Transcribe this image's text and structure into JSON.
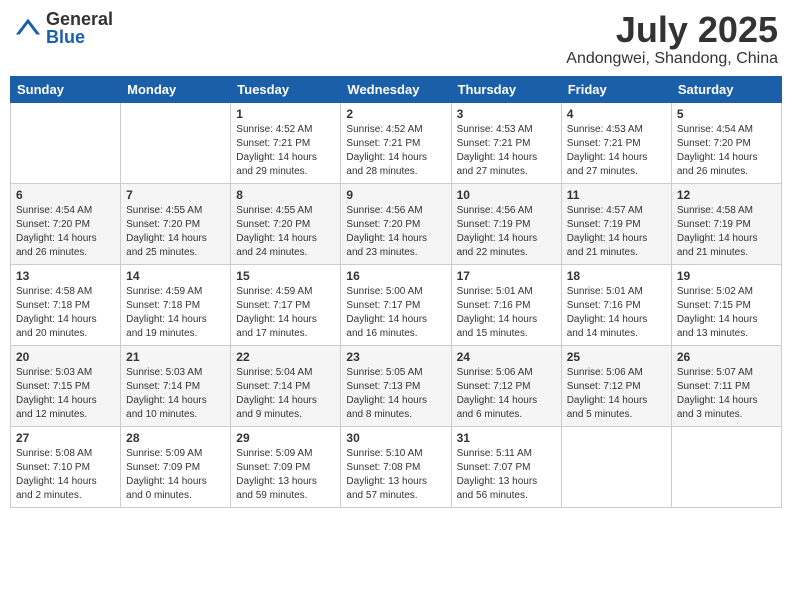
{
  "header": {
    "logo_general": "General",
    "logo_blue": "Blue",
    "month_title": "July 2025",
    "location": "Andongwei, Shandong, China"
  },
  "weekdays": [
    "Sunday",
    "Monday",
    "Tuesday",
    "Wednesday",
    "Thursday",
    "Friday",
    "Saturday"
  ],
  "weeks": [
    [
      {
        "day": null,
        "info": null
      },
      {
        "day": null,
        "info": null
      },
      {
        "day": "1",
        "info": "Sunrise: 4:52 AM\nSunset: 7:21 PM\nDaylight: 14 hours\nand 29 minutes."
      },
      {
        "day": "2",
        "info": "Sunrise: 4:52 AM\nSunset: 7:21 PM\nDaylight: 14 hours\nand 28 minutes."
      },
      {
        "day": "3",
        "info": "Sunrise: 4:53 AM\nSunset: 7:21 PM\nDaylight: 14 hours\nand 27 minutes."
      },
      {
        "day": "4",
        "info": "Sunrise: 4:53 AM\nSunset: 7:21 PM\nDaylight: 14 hours\nand 27 minutes."
      },
      {
        "day": "5",
        "info": "Sunrise: 4:54 AM\nSunset: 7:20 PM\nDaylight: 14 hours\nand 26 minutes."
      }
    ],
    [
      {
        "day": "6",
        "info": "Sunrise: 4:54 AM\nSunset: 7:20 PM\nDaylight: 14 hours\nand 26 minutes."
      },
      {
        "day": "7",
        "info": "Sunrise: 4:55 AM\nSunset: 7:20 PM\nDaylight: 14 hours\nand 25 minutes."
      },
      {
        "day": "8",
        "info": "Sunrise: 4:55 AM\nSunset: 7:20 PM\nDaylight: 14 hours\nand 24 minutes."
      },
      {
        "day": "9",
        "info": "Sunrise: 4:56 AM\nSunset: 7:20 PM\nDaylight: 14 hours\nand 23 minutes."
      },
      {
        "day": "10",
        "info": "Sunrise: 4:56 AM\nSunset: 7:19 PM\nDaylight: 14 hours\nand 22 minutes."
      },
      {
        "day": "11",
        "info": "Sunrise: 4:57 AM\nSunset: 7:19 PM\nDaylight: 14 hours\nand 21 minutes."
      },
      {
        "day": "12",
        "info": "Sunrise: 4:58 AM\nSunset: 7:19 PM\nDaylight: 14 hours\nand 21 minutes."
      }
    ],
    [
      {
        "day": "13",
        "info": "Sunrise: 4:58 AM\nSunset: 7:18 PM\nDaylight: 14 hours\nand 20 minutes."
      },
      {
        "day": "14",
        "info": "Sunrise: 4:59 AM\nSunset: 7:18 PM\nDaylight: 14 hours\nand 19 minutes."
      },
      {
        "day": "15",
        "info": "Sunrise: 4:59 AM\nSunset: 7:17 PM\nDaylight: 14 hours\nand 17 minutes."
      },
      {
        "day": "16",
        "info": "Sunrise: 5:00 AM\nSunset: 7:17 PM\nDaylight: 14 hours\nand 16 minutes."
      },
      {
        "day": "17",
        "info": "Sunrise: 5:01 AM\nSunset: 7:16 PM\nDaylight: 14 hours\nand 15 minutes."
      },
      {
        "day": "18",
        "info": "Sunrise: 5:01 AM\nSunset: 7:16 PM\nDaylight: 14 hours\nand 14 minutes."
      },
      {
        "day": "19",
        "info": "Sunrise: 5:02 AM\nSunset: 7:15 PM\nDaylight: 14 hours\nand 13 minutes."
      }
    ],
    [
      {
        "day": "20",
        "info": "Sunrise: 5:03 AM\nSunset: 7:15 PM\nDaylight: 14 hours\nand 12 minutes."
      },
      {
        "day": "21",
        "info": "Sunrise: 5:03 AM\nSunset: 7:14 PM\nDaylight: 14 hours\nand 10 minutes."
      },
      {
        "day": "22",
        "info": "Sunrise: 5:04 AM\nSunset: 7:14 PM\nDaylight: 14 hours\nand 9 minutes."
      },
      {
        "day": "23",
        "info": "Sunrise: 5:05 AM\nSunset: 7:13 PM\nDaylight: 14 hours\nand 8 minutes."
      },
      {
        "day": "24",
        "info": "Sunrise: 5:06 AM\nSunset: 7:12 PM\nDaylight: 14 hours\nand 6 minutes."
      },
      {
        "day": "25",
        "info": "Sunrise: 5:06 AM\nSunset: 7:12 PM\nDaylight: 14 hours\nand 5 minutes."
      },
      {
        "day": "26",
        "info": "Sunrise: 5:07 AM\nSunset: 7:11 PM\nDaylight: 14 hours\nand 3 minutes."
      }
    ],
    [
      {
        "day": "27",
        "info": "Sunrise: 5:08 AM\nSunset: 7:10 PM\nDaylight: 14 hours\nand 2 minutes."
      },
      {
        "day": "28",
        "info": "Sunrise: 5:09 AM\nSunset: 7:09 PM\nDaylight: 14 hours\nand 0 minutes."
      },
      {
        "day": "29",
        "info": "Sunrise: 5:09 AM\nSunset: 7:09 PM\nDaylight: 13 hours\nand 59 minutes."
      },
      {
        "day": "30",
        "info": "Sunrise: 5:10 AM\nSunset: 7:08 PM\nDaylight: 13 hours\nand 57 minutes."
      },
      {
        "day": "31",
        "info": "Sunrise: 5:11 AM\nSunset: 7:07 PM\nDaylight: 13 hours\nand 56 minutes."
      },
      {
        "day": null,
        "info": null
      },
      {
        "day": null,
        "info": null
      }
    ]
  ]
}
